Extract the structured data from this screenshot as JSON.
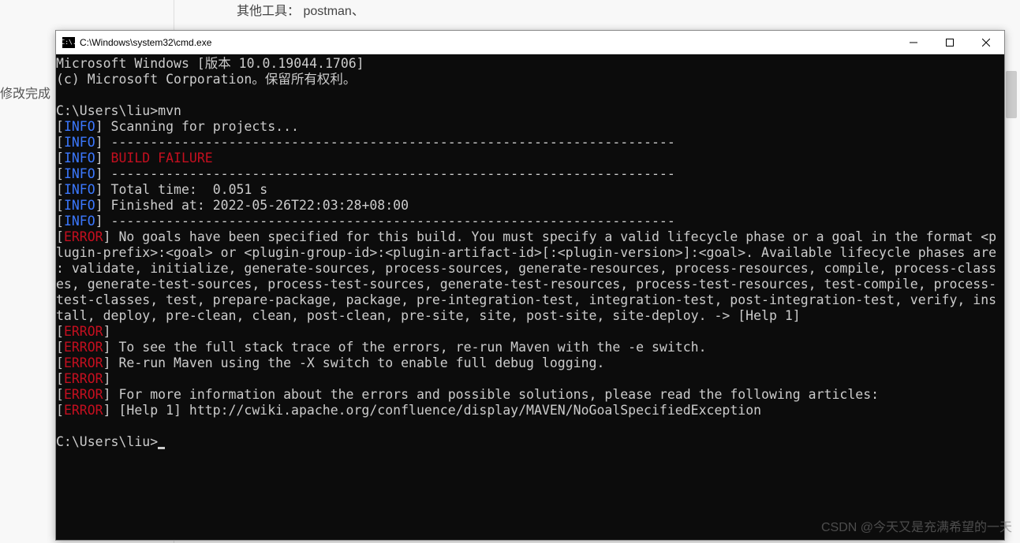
{
  "background": {
    "text1": "其他工具： postman、",
    "text2": "修改完成",
    "watermark": "CSDN @今天又是充满希望的一天"
  },
  "window": {
    "icon_label": "C:\\.",
    "title": "C:\\Windows\\system32\\cmd.exe"
  },
  "terminal": {
    "header1": "Microsoft Windows [版本 10.0.19044.1706]",
    "header2": "(c) Microsoft Corporation。保留所有权利。",
    "prompt1": "C:\\Users\\liu>",
    "cmd1": "mvn",
    "info_label": "INFO",
    "error_label": "ERROR",
    "scan": " Scanning for projects...",
    "dashes": " ------------------------------------------------------------------------",
    "build_failure": " BUILD FAILURE",
    "total_time": " Total time:  0.051 s",
    "finished_at": " Finished at: 2022-05-26T22:03:28+08:00",
    "err_l1": " No goals have been specified for this build. You must specify a valid lifecycle phase or a goal in the format <p",
    "err_l2": "lugin-prefix>:<goal> or <plugin-group-id>:<plugin-artifact-id>[:<plugin-version>]:<goal>. Available lifecycle phases are",
    "err_l3": ": validate, initialize, generate-sources, process-sources, generate-resources, process-resources, compile, process-class",
    "err_l4": "es, generate-test-sources, process-test-sources, generate-test-resources, process-test-resources, test-compile, process-",
    "err_l5": "test-classes, test, prepare-package, package, pre-integration-test, integration-test, post-integration-test, verify, ins",
    "err_l6": "tall, deploy, pre-clean, clean, post-clean, pre-site, site, post-site, site-deploy. -> [Help 1]",
    "err_trace": " To see the full stack trace of the errors, re-run Maven with the -e switch.",
    "err_rerun": " Re-run Maven using the -X switch to enable full debug logging.",
    "err_more": " For more information about the errors and possible solutions, please read the following articles:",
    "err_help": " [Help 1] http://cwiki.apache.org/confluence/display/MAVEN/NoGoalSpecifiedException",
    "prompt2": "C:\\Users\\liu>"
  }
}
